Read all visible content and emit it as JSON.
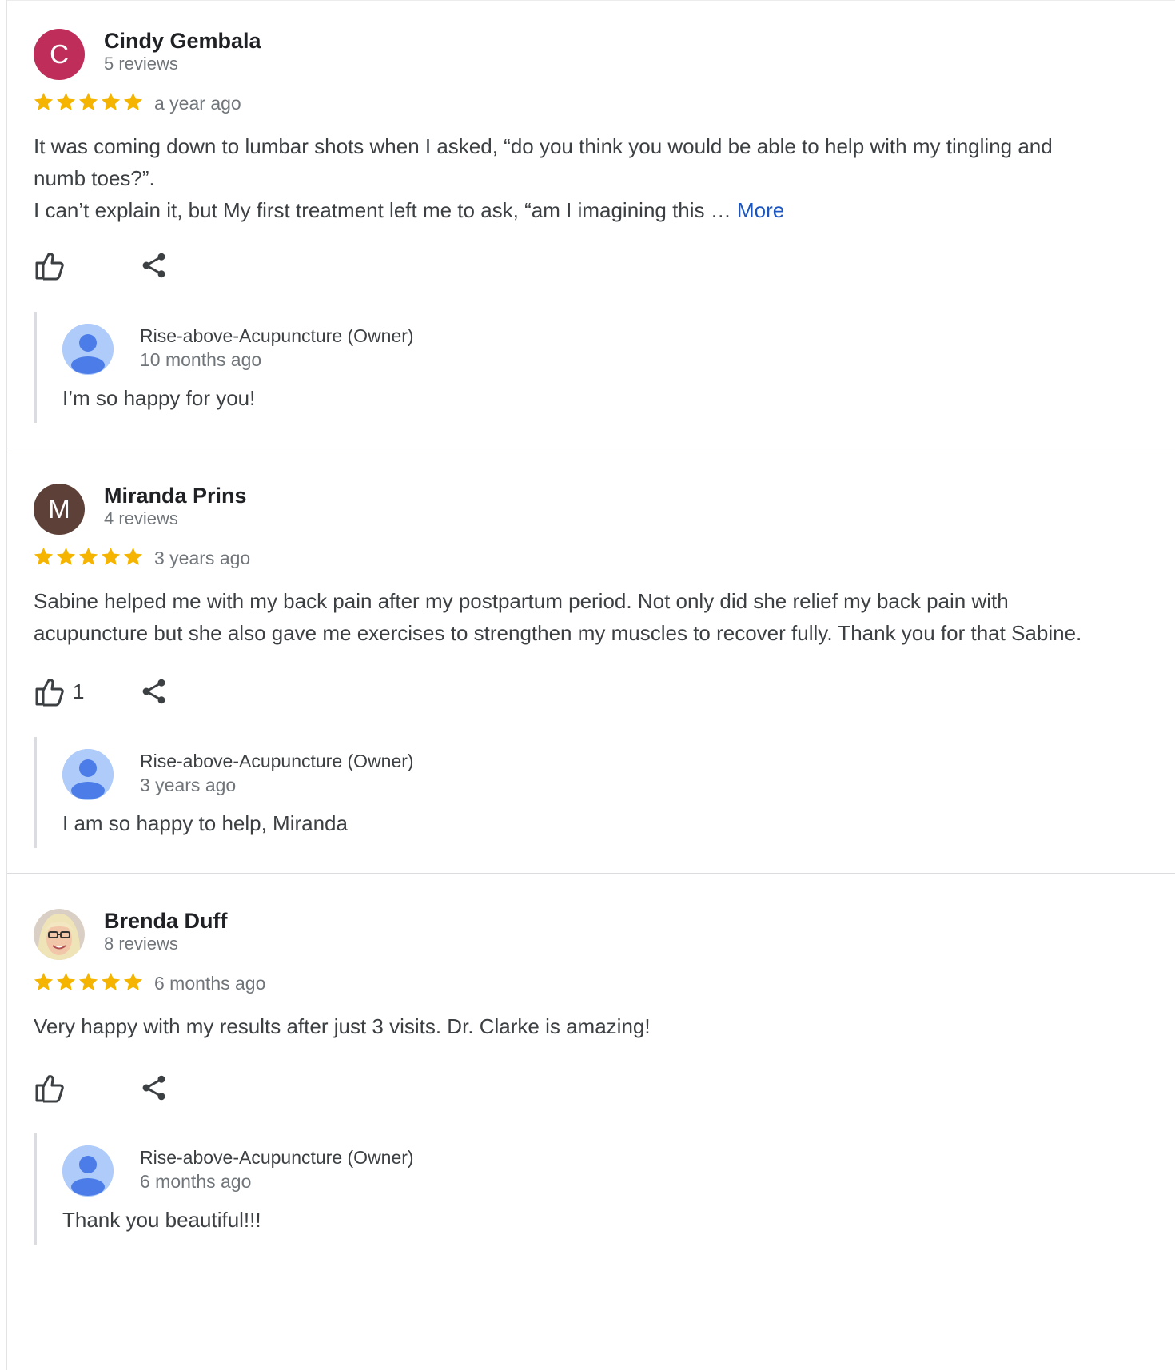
{
  "colors": {
    "star": "#f4b400",
    "link": "#1a55c0",
    "avatar_c": "#bf2e5b",
    "avatar_m": "#5d4037",
    "owner_avatar_bg": "#aecbfa",
    "owner_avatar_fg": "#4b7ce8"
  },
  "reviews": [
    {
      "avatar_letter": "C",
      "name": "Cindy Gembala",
      "review_count": "5 reviews",
      "rating": 5,
      "date": "a year ago",
      "text_line1": "It was coming down to lumbar shots when I asked, “do you think you would be able to help with my tingling and",
      "text_line2": "numb toes?”.",
      "text_line3": "I can’t explain it, but My first treatment left me to ask, “am I imagining this … ",
      "more_label": "More",
      "likes": "",
      "reply": {
        "name": "Rise-above-Acupuncture (Owner)",
        "date": "10 months ago",
        "text": "I’m so happy for you!"
      }
    },
    {
      "avatar_letter": "M",
      "name": "Miranda Prins",
      "review_count": "4 reviews",
      "rating": 5,
      "date": "3 years ago",
      "text_line1": "Sabine helped me with my back pain after my postpartum period. Not only did she relief my back pain with",
      "text_line2": "acupuncture but she also gave me exercises to strengthen my muscles to recover fully. Thank you for that Sabine.",
      "likes": "1",
      "reply": {
        "name": "Rise-above-Acupuncture (Owner)",
        "date": "3 years ago",
        "text": "I am so happy to help, Miranda"
      }
    },
    {
      "avatar_letter": "",
      "name": "Brenda Duff",
      "review_count": "8 reviews",
      "rating": 5,
      "date": "6 months ago",
      "text_line1": "Very happy with my results after just 3 visits. Dr. Clarke is amazing!",
      "likes": "",
      "reply": {
        "name": "Rise-above-Acupuncture (Owner)",
        "date": "6 months ago",
        "text": "Thank you beautiful!!!"
      }
    }
  ]
}
